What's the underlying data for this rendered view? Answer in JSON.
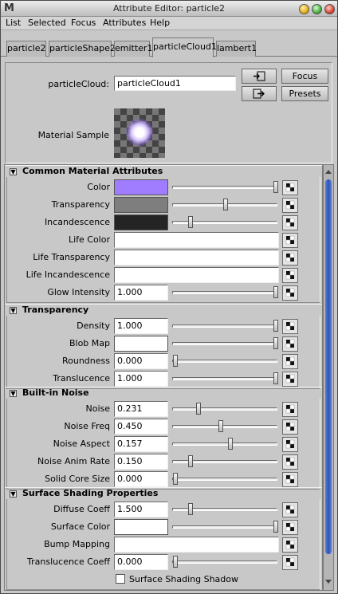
{
  "window": {
    "title": "Attribute Editor: particle2",
    "app_icon": "maya-m-icon"
  },
  "menu": [
    "List",
    "Selected",
    "Focus",
    "Attributes",
    "Help"
  ],
  "tabs": [
    "particle2",
    "particleShape2",
    "emitter1",
    "particleCloud1",
    "lambert1"
  ],
  "active_tab": "particleCloud1",
  "header": {
    "name_label": "particleCloud:",
    "name_value": "particleCloud1",
    "focus_button": "Focus",
    "presets_button": "Presets",
    "material_sample_label": "Material Sample"
  },
  "sections": [
    {
      "title": "Common Material Attributes",
      "rows": [
        {
          "label": "Color",
          "type": "swatch",
          "color": "#a07cff",
          "slider": 1.0
        },
        {
          "label": "Transparency",
          "type": "swatch",
          "color": "#7e7e7e",
          "slider": 0.5
        },
        {
          "label": "Incandescence",
          "type": "swatch",
          "color": "#242424",
          "slider": 0.15
        },
        {
          "label": "Life Color",
          "type": "wide"
        },
        {
          "label": "Life Transparency",
          "type": "wide"
        },
        {
          "label": "Life Incandescence",
          "type": "wide"
        },
        {
          "label": "Glow Intensity",
          "type": "num",
          "value": "1.000",
          "slider": 1.0
        }
      ]
    },
    {
      "title": "Transparency",
      "rows": [
        {
          "label": "Density",
          "type": "num",
          "value": "1.000",
          "slider": 1.0
        },
        {
          "label": "Blob Map",
          "type": "swatch",
          "color": "#ffffff",
          "slider": 1.0
        },
        {
          "label": "Roundness",
          "type": "num",
          "value": "0.000",
          "slider": 0.0
        },
        {
          "label": "Translucence",
          "type": "num",
          "value": "1.000",
          "slider": 1.0
        }
      ]
    },
    {
      "title": "Built-in Noise",
      "rows": [
        {
          "label": "Noise",
          "type": "num",
          "value": "0.231",
          "slider": 0.231
        },
        {
          "label": "Noise Freq",
          "type": "num",
          "value": "0.450",
          "slider": 0.45
        },
        {
          "label": "Noise Aspect",
          "type": "num",
          "value": "0.157",
          "slider": 0.55
        },
        {
          "label": "Noise Anim Rate",
          "type": "num",
          "value": "0.150",
          "slider": 0.15
        },
        {
          "label": "Solid Core Size",
          "type": "num",
          "value": "0.000",
          "slider": 0.0
        }
      ]
    },
    {
      "title": "Surface Shading Properties",
      "rows": [
        {
          "label": "Diffuse Coeff",
          "type": "num",
          "value": "1.500",
          "slider": 0.15
        },
        {
          "label": "Surface Color",
          "type": "swatch",
          "color": "#ffffff",
          "slider": 1.0
        },
        {
          "label": "Bump Mapping",
          "type": "wide"
        },
        {
          "label": "Translucence Coeff",
          "type": "num",
          "value": "0.000",
          "slider": 0.0
        },
        {
          "label": "Surface Shading Shadow",
          "type": "checkbox",
          "checked": false
        }
      ]
    }
  ]
}
